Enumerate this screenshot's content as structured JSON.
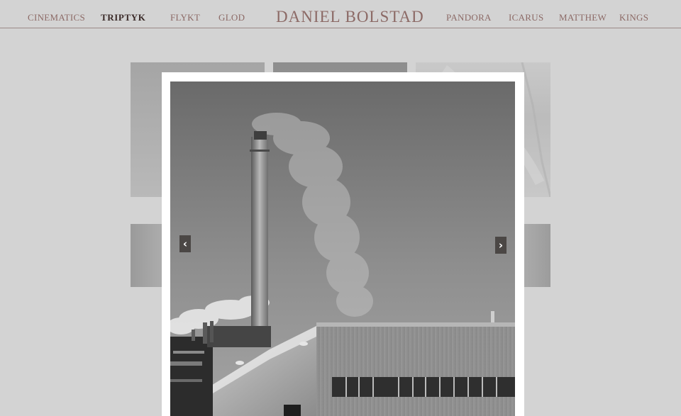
{
  "site": {
    "title": "DANIEL BOLSTAD"
  },
  "nav": {
    "left": [
      {
        "label": "CINEMATICS",
        "active": false
      },
      {
        "label": "TRIPTYK",
        "active": true
      },
      {
        "label": "FLYKT",
        "active": false
      },
      {
        "label": "GLOD",
        "active": false
      }
    ],
    "right": [
      {
        "label": "PANDORA",
        "active": false
      },
      {
        "label": "ICARUS",
        "active": false
      },
      {
        "label": "MATTHEW",
        "active": false
      },
      {
        "label": "KINGS",
        "active": false
      }
    ]
  },
  "lightbox": {
    "prev_glyph": "‹",
    "next_glyph": "›"
  },
  "colors": {
    "page_bg": "#d3d3d3",
    "nav_text": "#8c6a66",
    "nav_active_text": "#3a2a28",
    "frame": "#ffffff",
    "arrow_bg": "#4b4745"
  },
  "icons": {
    "prev": "chevron-left-icon",
    "next": "chevron-right-icon"
  }
}
